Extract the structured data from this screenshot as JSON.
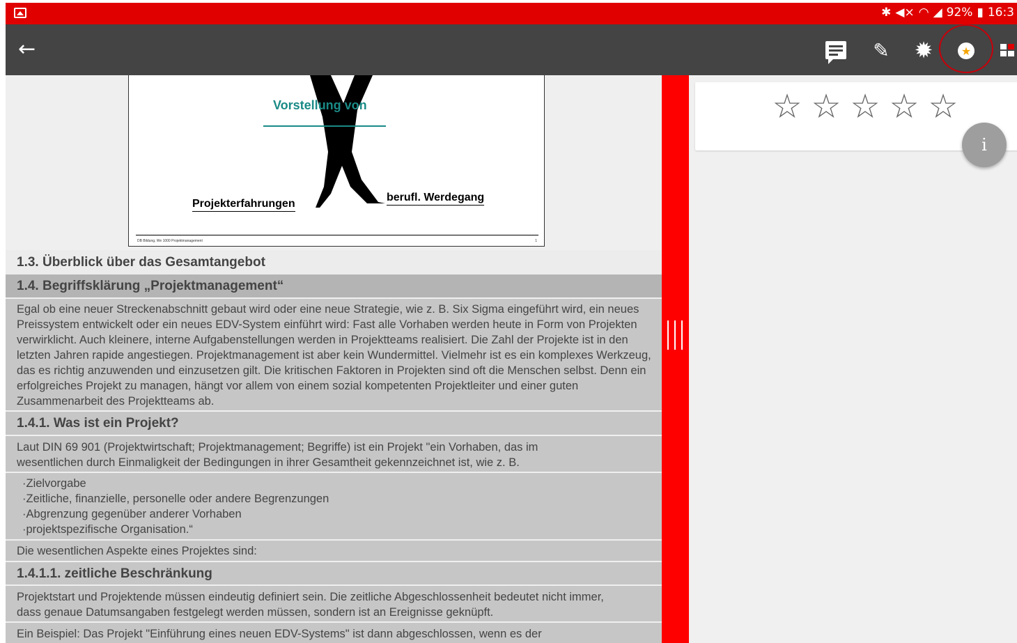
{
  "statusbar": {
    "battery": "92%",
    "time": "16:3",
    "icons": [
      "gallery-icon",
      "bluetooth-icon",
      "mute-icon",
      "wifi-icon",
      "signal-icon",
      "battery-icon"
    ]
  },
  "toolbar": {
    "back_icon": "←",
    "actions": [
      "comment-icon",
      "pencil-icon",
      "gear-icon",
      "star-icon",
      "grid-icon"
    ],
    "gear_glyph": "✹",
    "pencil_glyph": "✎",
    "star_glyph": "★",
    "colors": {
      "background": "#444444",
      "statusbar": "#e00000",
      "highlight_ring": "#c8000a",
      "star_fill": "#f5a400"
    }
  },
  "slide": {
    "title": "Vorstellung von",
    "label_left": "Projekterfahrungen",
    "label_right": "berufl. Werdegang",
    "footer": "DB Bildung, We 1000 Projektmanagement",
    "page_no": "1"
  },
  "document": {
    "h_1_3": "1.3.  Überblick über das Gesamtangebot",
    "h_1_4": "1.4.  Begriffsklärung „Projektmanagement“",
    "p_1": "Egal ob eine neuer Streckenabschnitt gebaut wird oder eine neue Strategie, wie z. B. Six Sigma eingeführt wird, ein neues Preissystem entwickelt oder ein neues EDV-System einführt wird: Fast alle Vorhaben werden heute in Form von Projekten verwirklicht. Auch kleinere, interne Aufgabenstellungen werden in Projektteams realisiert. Die Zahl der Projekte ist in den letzten Jahren rapide angestiegen. Projektmanagement ist aber kein Wundermittel. Vielmehr ist es ein komplexes Werkzeug, das es richtig anzuwenden und einzusetzen gilt. Die kritischen Faktoren in Projekten sind oft die Menschen selbst. Denn ein erfolgreiches Projekt zu managen, hängt vor allem von einem sozial kompetenten Projektleiter und einer guten Zusammenarbeit des Projektteams ab.",
    "h_1_4_1": "1.4.1.   Was ist ein Projekt?",
    "p_2": "Laut DIN 69 901 (Projektwirtschaft; Projektmanagement; Begriffe) ist ein Projekt \"ein Vorhaben, das im wesentlichen durch Einmaligkeit der Bedingungen in ihrer Gesamtheit gekennzeichnet ist, wie z. B.",
    "list": [
      "·Zielvorgabe",
      "·Zeitliche, finanzielle, personelle oder andere Begrenzungen",
      "·Abgrenzung gegenüber anderer Vorhaben",
      "·projektspezifische Organisation.“"
    ],
    "p_3": "Die wesentlichen Aspekte eines Projektes sind:",
    "h_1_4_1_1": "1.4.1.1.    zeitliche Beschränkung",
    "p_4": "Projektstart und Projektende müssen eindeutig definiert sein. Die zeitliche Abgeschlossenheit bedeutet nicht immer, dass genaue Datumsangaben festgelegt werden müssen, sondern ist an Ereignisse geknüpft.",
    "p_5": "Ein Beispiel: Das Projekt \"Einführung eines neuen EDV-Systems\" ist dann abgeschlossen, wenn es der"
  },
  "rating": {
    "stars": [
      "☆",
      "☆",
      "☆",
      "☆",
      "☆"
    ],
    "rating_value": 0,
    "max": 5
  },
  "info_button": "i"
}
